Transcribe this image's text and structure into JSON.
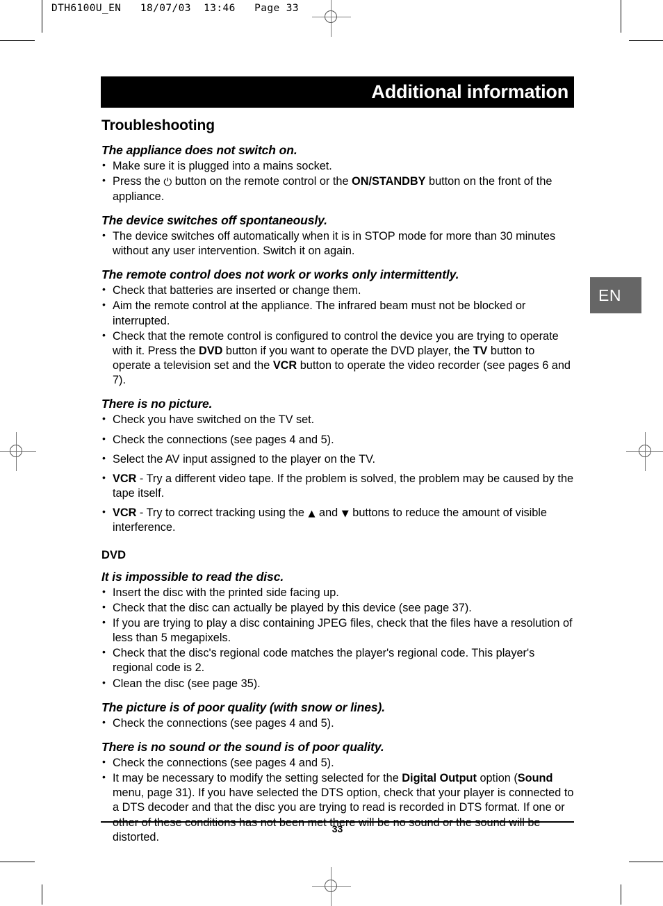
{
  "print_marks": {
    "file_header": "DTH6100U_EN   18/07/03  13:46   Page 33"
  },
  "language_tab": {
    "label": "EN",
    "color": "#666666"
  },
  "banner": {
    "title": "Additional information",
    "background": "#000000",
    "text_color": "#ffffff"
  },
  "content": {
    "section_title": "Troubleshooting",
    "faults": [
      {
        "heading": "The appliance does not switch on.",
        "items": [
          "Make sure it is plugged into a mains socket.",
          "Press the ⏻ button on the remote control or the ON/STANDBY button on the front of the appliance."
        ]
      },
      {
        "heading": "The device switches off spontaneously.",
        "items": [
          "The device switches off automatically when it is in STOP mode for more than 30 minutes without any user intervention. Switch it on again."
        ]
      },
      {
        "heading": "The remote control does not work or works only intermittently.",
        "items": [
          "Check that batteries are inserted or change them.",
          "Aim the remote control at the appliance. The infrared beam must not be blocked or interrupted.",
          "Check that the remote control is configured to control the device you are trying to operate with it. Press the DVD button if you want to operate the DVD player, the TV button to operate a television set and the VCR button to operate the video recorder (see pages 6 and 7)."
        ]
      },
      {
        "heading": "There is no picture.",
        "items": [
          "Check you have switched on the TV set.",
          "Check the connections (see pages 4 and 5).",
          "Select the AV input assigned to the player on the TV.",
          "VCR - Try a different video tape. If the problem is solved, the problem may be caused by the tape itself.",
          "VCR - Try to correct tracking using the ▲ and ▼ buttons to reduce the amount of visible interference."
        ]
      }
    ],
    "group_heading": "DVD",
    "dvd_faults": [
      {
        "heading": "It is impossible to read the disc.",
        "items": [
          "Insert the disc with the printed side facing up.",
          "Check that the disc can actually be played by this device (see page 37).",
          "If you are trying to play a disc containing JPEG files, check that the files have a resolution of less than 5 megapixels.",
          "Check that the disc's regional code matches the player's regional code. This player's regional code is 2.",
          "Clean the disc (see page 35)."
        ]
      },
      {
        "heading": "The picture is of poor quality (with snow or lines).",
        "items": [
          "Check the connections (see pages 4 and 5)."
        ]
      },
      {
        "heading": "There is no sound or the sound is of poor quality.",
        "items": [
          "Check the connections (see pages 4 and 5).",
          "It may be necessary to modify the setting selected for the Digital Output option (Sound menu, page 31). If you have selected the DTS option, check that your player is connected to a DTS decoder and that the disc you are trying to read is recorded in DTS format. If one or other of these conditions has not been met there will be no sound or the sound will be distorted."
        ]
      }
    ]
  },
  "footer": {
    "page_number": "33"
  }
}
